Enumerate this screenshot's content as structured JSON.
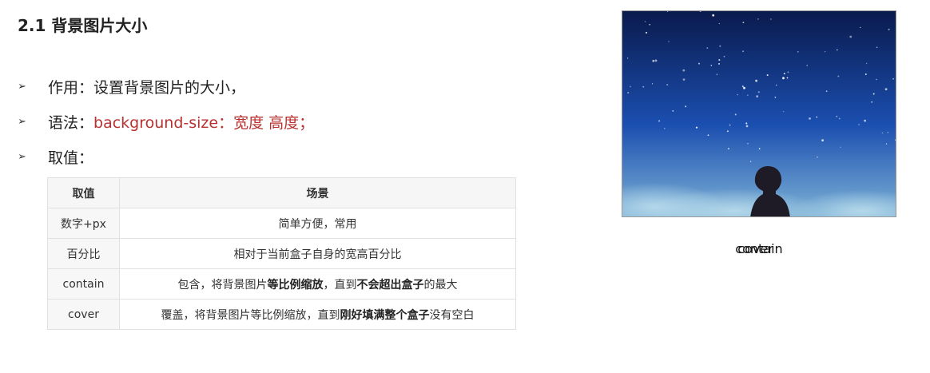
{
  "section": {
    "title": "2.1 背景图片大小"
  },
  "bullets": [
    {
      "marker": "➢",
      "text": "作用：设置背景图片的大小，"
    },
    {
      "marker": "➢",
      "label": "语法：",
      "code": "background-size：宽度 高度；"
    },
    {
      "marker": "➢",
      "text": "取值："
    }
  ],
  "table": {
    "headers": [
      "取值",
      "场景"
    ],
    "rows": [
      {
        "key": "数字+px",
        "desc": [
          {
            "t": "简单方便，常用"
          }
        ]
      },
      {
        "key": "百分比",
        "desc": [
          {
            "t": "相对于当前盒子自身的宽高百分比"
          }
        ]
      },
      {
        "key": "contain",
        "desc": [
          {
            "t": "包含，将背景图片"
          },
          {
            "t": "等比例缩放",
            "b": true
          },
          {
            "t": "，直到"
          },
          {
            "t": "不会超出盒子",
            "b": true
          },
          {
            "t": "的最大"
          }
        ]
      },
      {
        "key": "cover",
        "desc": [
          {
            "t": "覆盖，将背景图片等比例缩放，直到"
          },
          {
            "t": "刚好填满整个盒子",
            "b": true
          },
          {
            "t": "没有空白"
          }
        ]
      }
    ]
  },
  "image": {
    "subject": "night-sky-silhouette",
    "colors": {
      "top": "#0a1a4d",
      "middle": "#1b4fb0",
      "horizon": "#7fb3d6",
      "silhouette": "#1e1a26"
    }
  },
  "caption": {
    "text_a": "cover",
    "text_b": "contain"
  }
}
